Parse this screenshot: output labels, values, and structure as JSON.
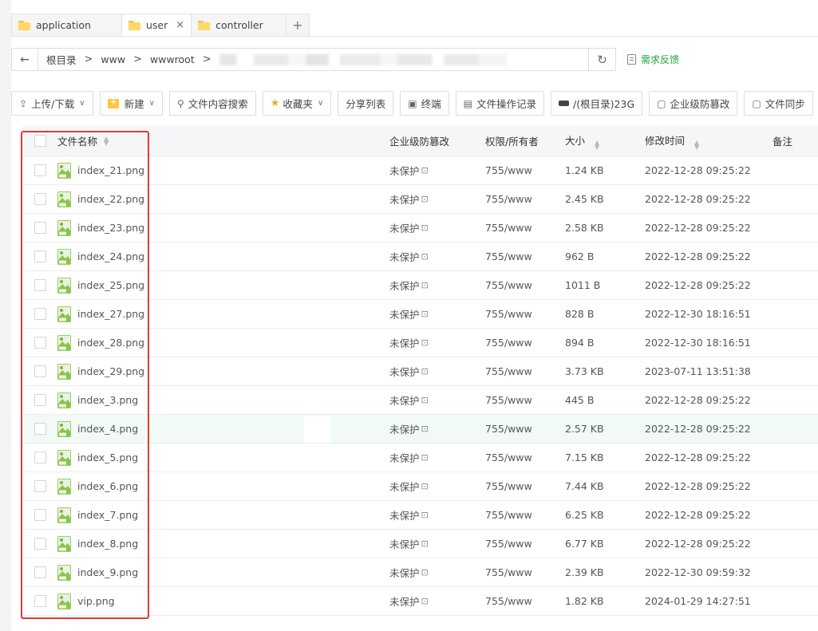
{
  "tabs": [
    {
      "label": "application",
      "active": false,
      "closable": false
    },
    {
      "label": "user",
      "active": true,
      "closable": true
    },
    {
      "label": "controller",
      "active": false,
      "closable": false
    }
  ],
  "tab_add": "+",
  "tab_close": "×",
  "path": {
    "back": "←",
    "crumbs": [
      "根目录",
      "www",
      "wwwroot"
    ],
    "separator": ">",
    "refresh": "↻"
  },
  "feedback": "需求反馈",
  "toolbar": {
    "upload": "上传/下载",
    "new": "新建",
    "search": "文件内容搜索",
    "favorites": "收藏夹",
    "share": "分享列表",
    "terminal": "终端",
    "oplog": "文件操作记录",
    "disk": "/(根目录)23G",
    "tamper": "企业级防篡改",
    "sync": "文件同步"
  },
  "columns": {
    "name": "文件名称",
    "protect": "企业级防篡改",
    "perm": "权限/所有者",
    "size": "大小",
    "time": "修改时间",
    "note": "备注"
  },
  "files": [
    {
      "name": "index_21.png",
      "protect": "未保护",
      "perm": "755/www",
      "size": "1.24 KB",
      "time": "2022-12-28 09:25:22"
    },
    {
      "name": "index_22.png",
      "protect": "未保护",
      "perm": "755/www",
      "size": "2.45 KB",
      "time": "2022-12-28 09:25:22"
    },
    {
      "name": "index_23.png",
      "protect": "未保护",
      "perm": "755/www",
      "size": "2.58 KB",
      "time": "2022-12-28 09:25:22"
    },
    {
      "name": "index_24.png",
      "protect": "未保护",
      "perm": "755/www",
      "size": "962 B",
      "time": "2022-12-28 09:25:22"
    },
    {
      "name": "index_25.png",
      "protect": "未保护",
      "perm": "755/www",
      "size": "1011 B",
      "time": "2022-12-28 09:25:22"
    },
    {
      "name": "index_27.png",
      "protect": "未保护",
      "perm": "755/www",
      "size": "828 B",
      "time": "2022-12-30 18:16:51"
    },
    {
      "name": "index_28.png",
      "protect": "未保护",
      "perm": "755/www",
      "size": "894 B",
      "time": "2022-12-30 18:16:51"
    },
    {
      "name": "index_29.png",
      "protect": "未保护",
      "perm": "755/www",
      "size": "3.73 KB",
      "time": "2023-07-11 13:51:38"
    },
    {
      "name": "index_3.png",
      "protect": "未保护",
      "perm": "755/www",
      "size": "445 B",
      "time": "2022-12-28 09:25:22"
    },
    {
      "name": "index_4.png",
      "protect": "未保护",
      "perm": "755/www",
      "size": "2.57 KB",
      "time": "2022-12-28 09:25:22",
      "highlight": true
    },
    {
      "name": "index_5.png",
      "protect": "未保护",
      "perm": "755/www",
      "size": "7.15 KB",
      "time": "2022-12-28 09:25:22"
    },
    {
      "name": "index_6.png",
      "protect": "未保护",
      "perm": "755/www",
      "size": "7.44 KB",
      "time": "2022-12-28 09:25:22"
    },
    {
      "name": "index_7.png",
      "protect": "未保护",
      "perm": "755/www",
      "size": "6.25 KB",
      "time": "2022-12-28 09:25:22"
    },
    {
      "name": "index_8.png",
      "protect": "未保护",
      "perm": "755/www",
      "size": "6.77 KB",
      "time": "2022-12-28 09:25:22"
    },
    {
      "name": "index_9.png",
      "protect": "未保护",
      "perm": "755/www",
      "size": "2.39 KB",
      "time": "2022-12-30 09:59:32"
    },
    {
      "name": "vip.png",
      "protect": "未保护",
      "perm": "755/www",
      "size": "1.82 KB",
      "time": "2024-01-29 14:27:51"
    }
  ],
  "colors": {
    "accent": "#20a53a",
    "highlight_box": "#e53935",
    "row_highlight": "#f1faf5"
  }
}
